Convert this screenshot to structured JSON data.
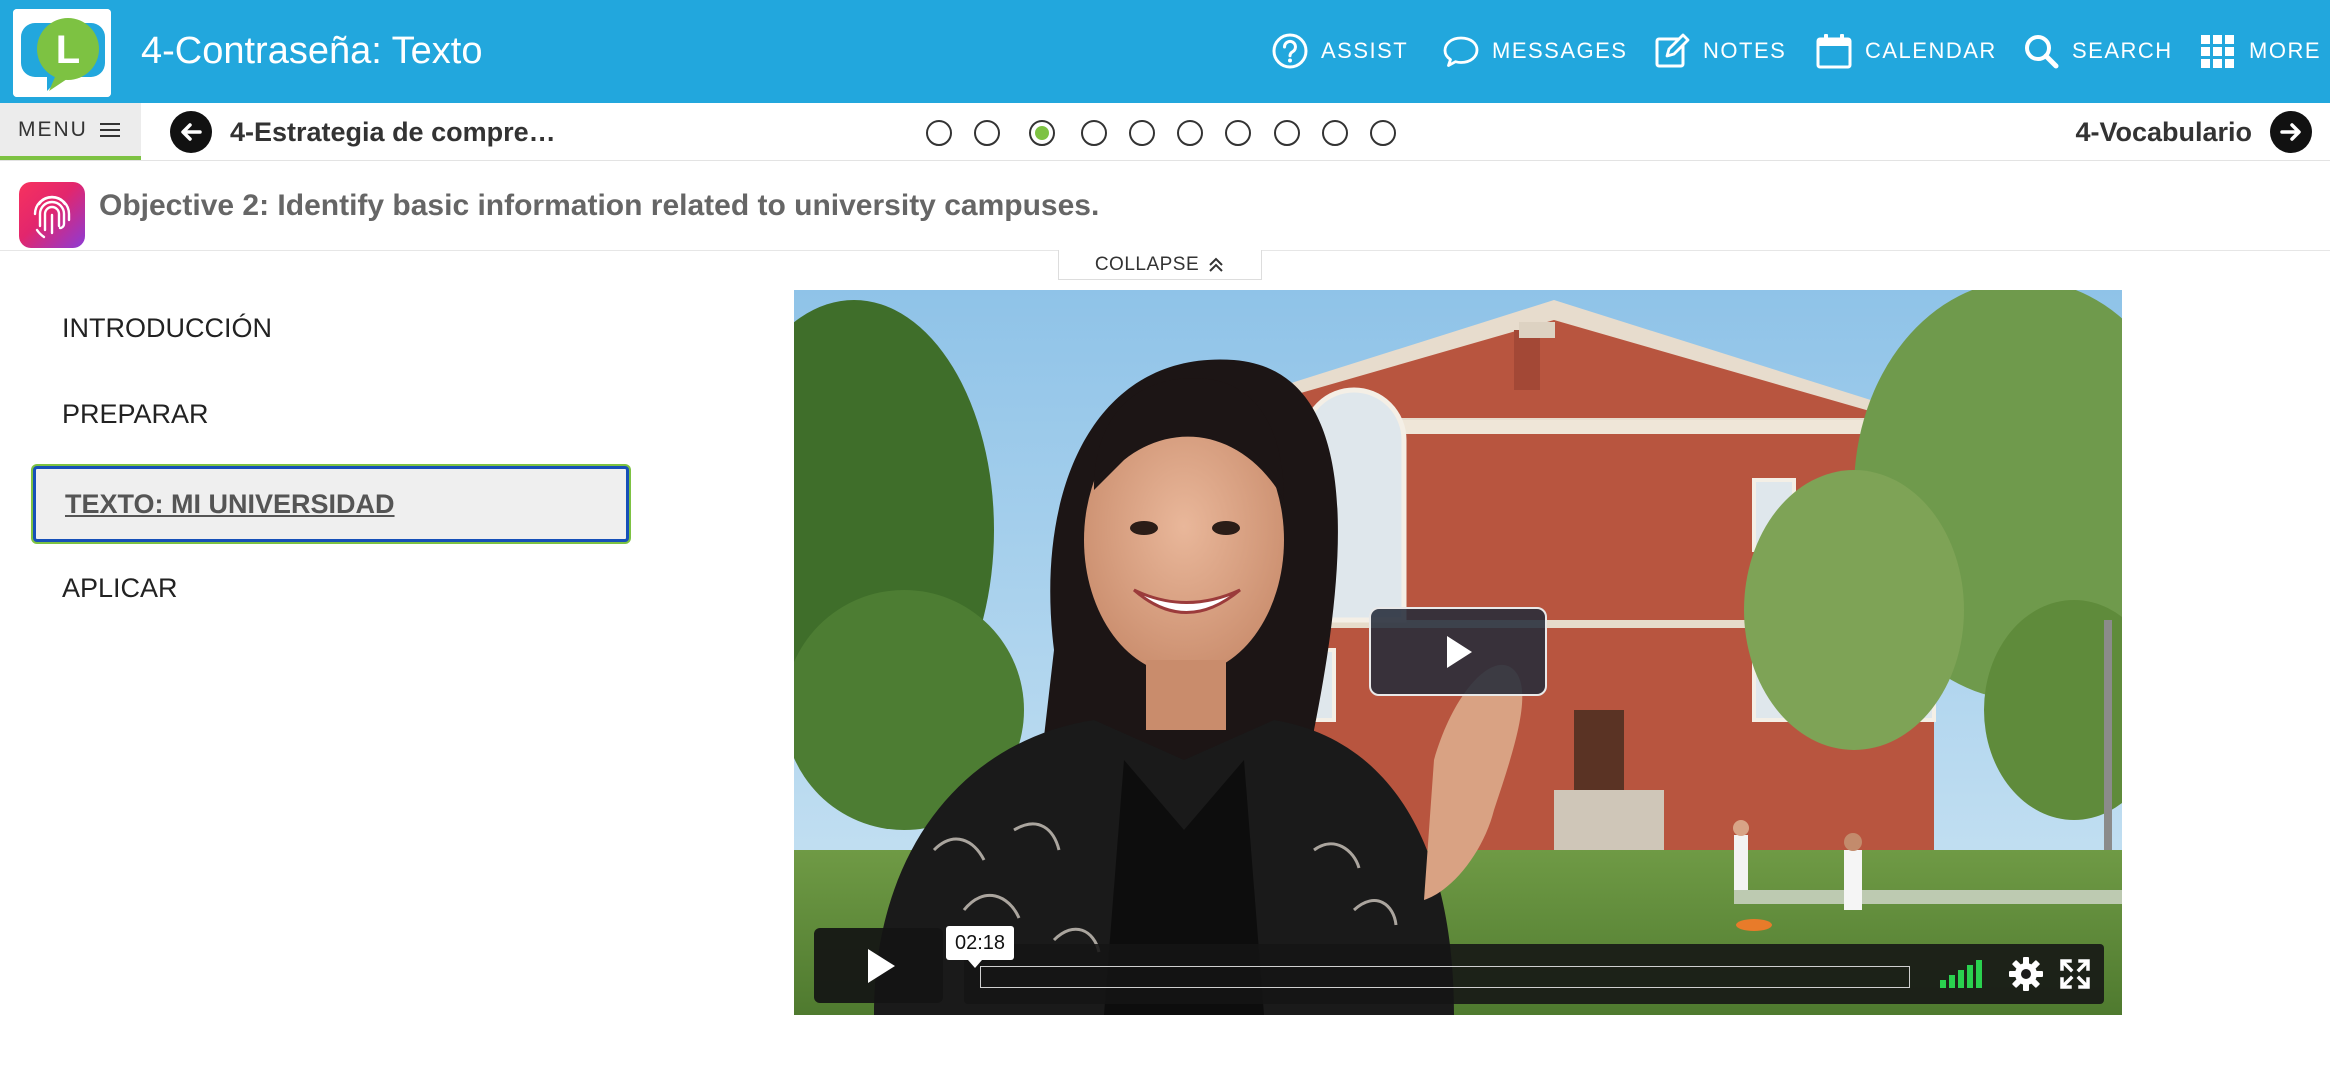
{
  "header": {
    "title": "4-Contraseña: Texto",
    "nav": [
      {
        "label": "ASSIST",
        "icon": "help-circle-icon"
      },
      {
        "label": "MESSAGES",
        "icon": "chat-bubble-icon"
      },
      {
        "label": "NOTES",
        "icon": "note-edit-icon"
      },
      {
        "label": "CALENDAR",
        "icon": "calendar-icon"
      },
      {
        "label": "SEARCH",
        "icon": "search-icon"
      },
      {
        "label": "MORE",
        "icon": "grid-icon"
      }
    ],
    "brand_color": "#22a7dd",
    "logo_letter": "L"
  },
  "subnav": {
    "menu_label": "MENU",
    "prev_label": "4-Estrategia de compre…",
    "next_label": "4-Vocabulario",
    "dots_total": 10,
    "dots_active_index": 2,
    "accent": "#7dc242"
  },
  "objective": {
    "text": "Objective 2: Identify basic information related to university campuses.",
    "icon": "fingerprint-icon"
  },
  "collapse": {
    "label": "COLLAPSE"
  },
  "sidebar": {
    "items": [
      {
        "label": "INTRODUCCIÓN",
        "selected": false
      },
      {
        "label": "PREPARAR",
        "selected": false
      },
      {
        "label": "TEXTO: MI UNIVERSIDAD",
        "selected": true
      },
      {
        "label": "APLICAR",
        "selected": false
      }
    ]
  },
  "video": {
    "time": "02:18",
    "progress": 0.0,
    "volume_bars": 5
  }
}
